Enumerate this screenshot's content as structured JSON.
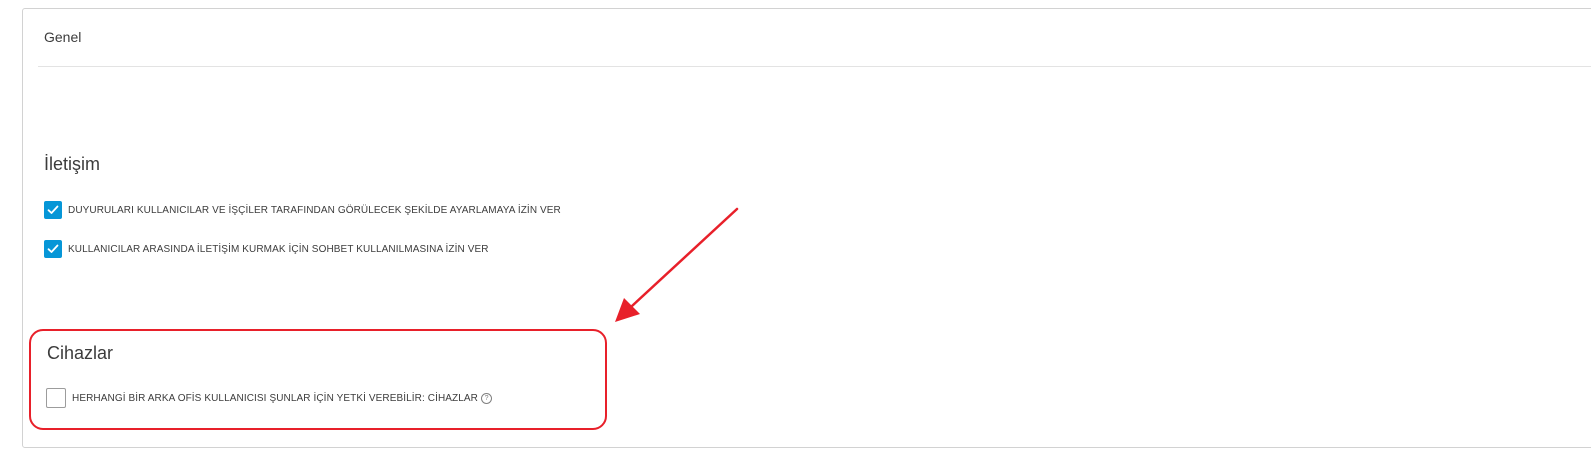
{
  "panel": {
    "title": "Genel"
  },
  "communication": {
    "heading": "İletişim",
    "options": [
      {
        "label": "DUYURULARI KULLANICILAR VE İŞÇİLER TARAFINDAN GÖRÜLECEK ŞEKİLDE AYARLAMAYA İZİN VER",
        "checked": true
      },
      {
        "label": "KULLANICILAR ARASINDA İLETİŞİM KURMAK İÇİN SOHBET KULLANILMASINA İZİN VER",
        "checked": true
      }
    ]
  },
  "devices": {
    "heading": "Cihazlar",
    "options": [
      {
        "label": "HERHANGİ BİR ARKA OFİS KULLANICISI ŞUNLAR İÇİN YETKİ VEREBİLİR: CİHAZLAR",
        "checked": false,
        "help_icon": "question-circle-icon"
      }
    ]
  },
  "annotation": {
    "color": "#e8202a",
    "arrow_icon": "arrow-icon"
  },
  "colors": {
    "accent": "#0696d7",
    "text": "#3c3c3c",
    "border": "#d2d2d2"
  }
}
